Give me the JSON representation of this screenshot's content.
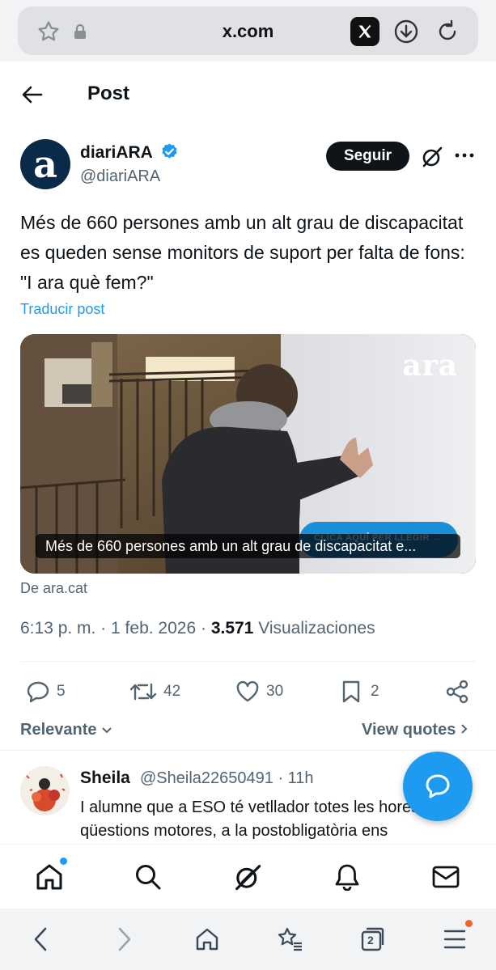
{
  "browser": {
    "url": "x.com",
    "icons": [
      "star-icon",
      "lock-icon",
      "x-logo-icon",
      "download-icon",
      "reload-icon"
    ],
    "tab_count": "2"
  },
  "header": {
    "back_icon": "arrow-left-icon",
    "title": "Post"
  },
  "author": {
    "avatar_letter": "a",
    "name": "diariARA",
    "handle": "@diariARA",
    "verified_color": "#1d9bf0",
    "follow_label": "Seguir"
  },
  "post": {
    "text": "Més de 660 persones amb un alt grau de discapacitat es queden sense monitors de suport per falta de fons: \"I ara què fem?\"",
    "translate_label": "Traducir post",
    "card": {
      "logo": "ara",
      "cta": "CLICA AQUÍ PER LLEGIR  →",
      "caption": "Més de 660 persones amb un alt grau de discapacitat e..."
    },
    "source": "De ara.cat",
    "time": "6:13 p. m. · 1 feb. 2026 · ",
    "views_count": "3.571",
    "views_label": " Visualizaciones"
  },
  "actions": {
    "replies": "5",
    "reposts": "42",
    "likes": "30",
    "bookmarks": "2"
  },
  "sort": {
    "label": "Relevante",
    "view_quotes": "View quotes"
  },
  "reply": {
    "name": "Sheila",
    "handle": "@Sheila22650491 · 11h",
    "text": "I alumne que a ESO té vetllador totes les hores per qüestions motores, a la postobligatòria ens"
  },
  "colors": {
    "accent": "#1d9bf0",
    "text": "#0f1419",
    "muted": "#536471"
  }
}
